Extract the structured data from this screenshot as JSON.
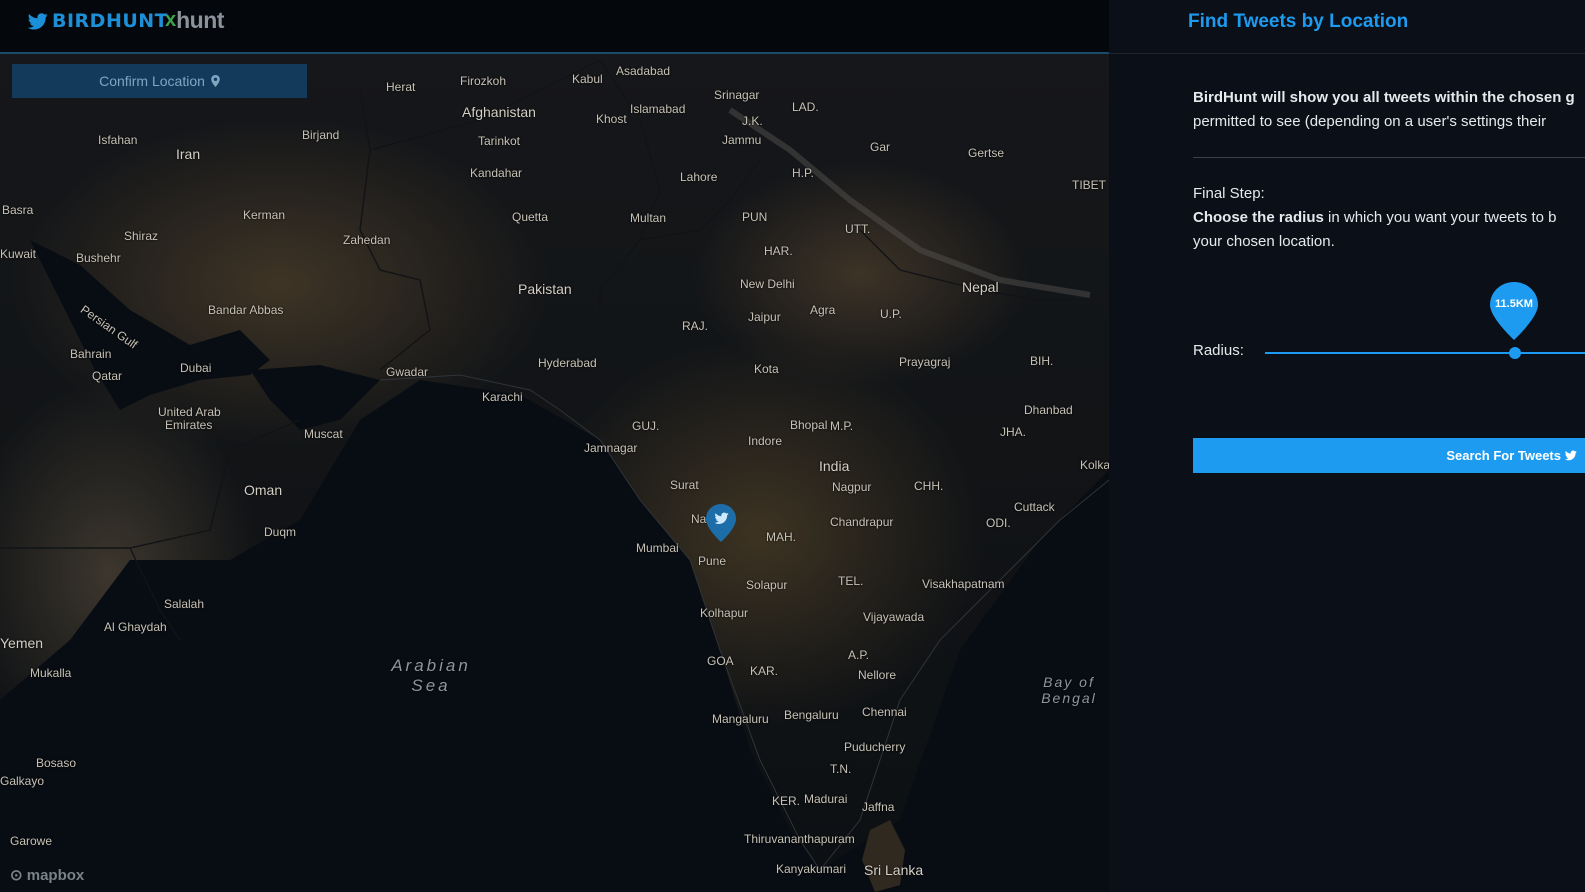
{
  "header": {
    "logo_text": "BIRDHUNT",
    "xhunt_x": "x",
    "xhunt_word": "hunt"
  },
  "map": {
    "confirm_label": "Confirm Location",
    "attribution": "mapbox",
    "labels": [
      {
        "text": "Herat"
      },
      {
        "text": "Firozkoh"
      },
      {
        "text": "Kabul"
      },
      {
        "text": "Asadabad"
      },
      {
        "text": "Afghanistan"
      },
      {
        "text": "Islamabad"
      },
      {
        "text": "Khost"
      },
      {
        "text": "Srinagar"
      },
      {
        "text": "LAD."
      },
      {
        "text": "J.K."
      },
      {
        "text": "Jammu"
      },
      {
        "text": "Iran"
      },
      {
        "text": "Isfahan"
      },
      {
        "text": "Birjand"
      },
      {
        "text": "Tarinkot"
      },
      {
        "text": "Kandahar"
      },
      {
        "text": "Lahore"
      },
      {
        "text": "H.P."
      },
      {
        "text": "Gar"
      },
      {
        "text": "Gertse"
      },
      {
        "text": "TIBET"
      },
      {
        "text": "Kerman"
      },
      {
        "text": "Zahedan"
      },
      {
        "text": "Quetta"
      },
      {
        "text": "Multan"
      },
      {
        "text": "PUN"
      },
      {
        "text": "UTT."
      },
      {
        "text": "Shiraz"
      },
      {
        "text": "Bushehr"
      },
      {
        "text": "Basra"
      },
      {
        "text": "Kuwait"
      },
      {
        "text": "Pakistan"
      },
      {
        "text": "HAR."
      },
      {
        "text": "New Delhi"
      },
      {
        "text": "Nepal"
      },
      {
        "text": "Bandar Abbas"
      },
      {
        "text": "Persian Gulf"
      },
      {
        "text": "Jaipur"
      },
      {
        "text": "Agra"
      },
      {
        "text": "U.P."
      },
      {
        "text": "RAJ."
      },
      {
        "text": "Bahrain"
      },
      {
        "text": "Dubai"
      },
      {
        "text": "Qatar"
      },
      {
        "text": "Gwadar"
      },
      {
        "text": "Hyderabad"
      },
      {
        "text": "Prayagraj"
      },
      {
        "text": "BIH."
      },
      {
        "text": "Kota"
      },
      {
        "text": "Karachi"
      },
      {
        "text": "United Arab"
      },
      {
        "text": "Emirates"
      },
      {
        "text": "Muscat"
      },
      {
        "text": "Dhanbad"
      },
      {
        "text": "GUJ."
      },
      {
        "text": "Bhopal"
      },
      {
        "text": "M.P."
      },
      {
        "text": "JHA."
      },
      {
        "text": "Indore"
      },
      {
        "text": "Jamnagar"
      },
      {
        "text": "India"
      },
      {
        "text": "Kolkata"
      },
      {
        "text": "Oman"
      },
      {
        "text": "Surat"
      },
      {
        "text": "Nagpur"
      },
      {
        "text": "CHH."
      },
      {
        "text": "Cuttack"
      },
      {
        "text": "Duqm"
      },
      {
        "text": "Nashik"
      },
      {
        "text": "Chandrapur"
      },
      {
        "text": "ODI."
      },
      {
        "text": "MAH."
      },
      {
        "text": "Mumbai"
      },
      {
        "text": "Pune"
      },
      {
        "text": "Solapur"
      },
      {
        "text": "TEL."
      },
      {
        "text": "Visakhapatnam"
      },
      {
        "text": "Salalah"
      },
      {
        "text": "Al Ghaydah"
      },
      {
        "text": "Kolhapur"
      },
      {
        "text": "Vijayawada"
      },
      {
        "text": "Yemen"
      },
      {
        "text": "Mukalla"
      },
      {
        "text": "GOA"
      },
      {
        "text": "KAR."
      },
      {
        "text": "A.P."
      },
      {
        "text": "Arabian Sea"
      },
      {
        "text": "Nellore"
      },
      {
        "text": "Bay of Bengal"
      },
      {
        "text": "Mangaluru"
      },
      {
        "text": "Bengaluru"
      },
      {
        "text": "Chennai"
      },
      {
        "text": "Puducherry"
      },
      {
        "text": "Bosaso"
      },
      {
        "text": "T.N."
      },
      {
        "text": "KER."
      },
      {
        "text": "Madurai"
      },
      {
        "text": "Jaffna"
      },
      {
        "text": "Thiruvananthapuram"
      },
      {
        "text": "Garowe"
      },
      {
        "text": "Kanyakumari"
      },
      {
        "text": "Sri Lanka"
      },
      {
        "text": "Galkayo"
      }
    ]
  },
  "panel": {
    "title": "Find Tweets by Location",
    "intro_bold": "BirdHunt will show you all tweets within the chosen g",
    "intro_rest": "permitted to see (depending on a user's settings their",
    "step_title": "Final Step:",
    "step_bold": "Choose the radius",
    "step_rest": " in which you want your tweets to b",
    "step_line2": "your chosen location.",
    "radius_label": "Radius:",
    "radius_value": "11.5KM",
    "radius_fraction": 0.78,
    "search_label": "Search For Tweets"
  },
  "colors": {
    "accent": "#1d9bf0",
    "panel_bg": "#0b0f17",
    "confirm_bg": "#133a5a"
  },
  "icons": [
    "twitter-bird-icon",
    "location-pin-icon",
    "map-marker-icon"
  ]
}
